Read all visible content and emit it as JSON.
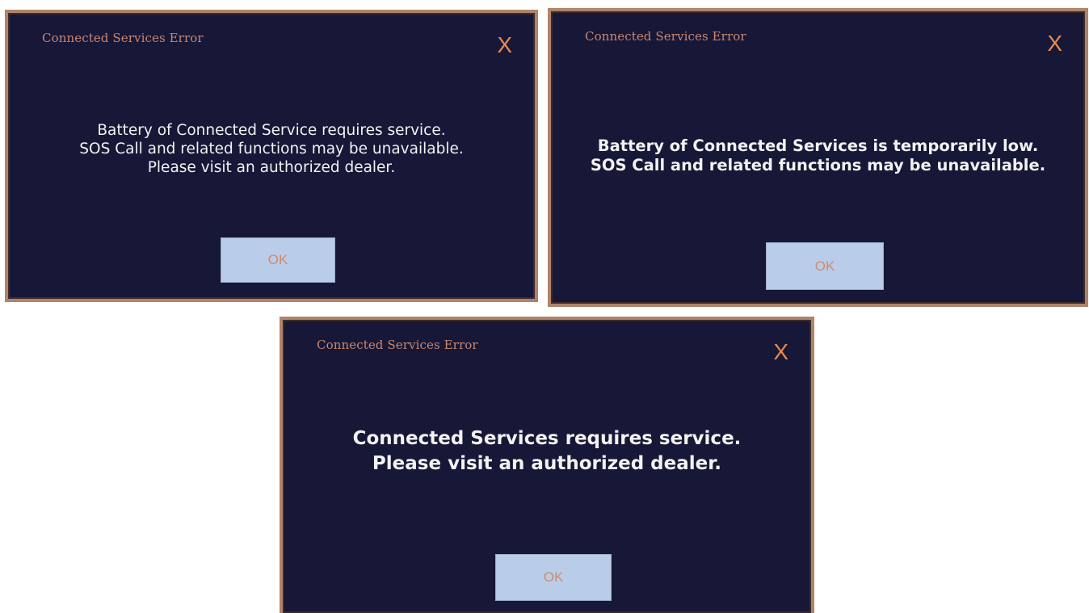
{
  "dialogs": [
    {
      "title": "Connected Services Error",
      "close_label": "X",
      "message_lines": [
        "Battery of Connected Service requires service.",
        "SOS Call and related functions may be unavailable.",
        "Please visit an authorized dealer."
      ],
      "ok_label": "OK"
    },
    {
      "title": "Connected Services Error",
      "close_label": "X",
      "message_lines": [
        "Battery of Connected Services is temporarily low.",
        "SOS Call and related functions may be unavailable."
      ],
      "ok_label": "OK"
    },
    {
      "title": "Connected Services Error",
      "close_label": "X",
      "message_lines": [
        "Connected Services requires service.",
        "Please visit an authorized dealer."
      ],
      "ok_label": "OK"
    }
  ],
  "colors": {
    "dialog_background": "#171737",
    "dialog_border": "#b0836b",
    "title_text": "#c98770",
    "close_icon": "#e9894f",
    "message_text": "#f2f2f2",
    "ok_button_background": "#b9cde8",
    "ok_button_text": "#d28a6f"
  },
  "icons": {
    "close": "close-icon"
  }
}
